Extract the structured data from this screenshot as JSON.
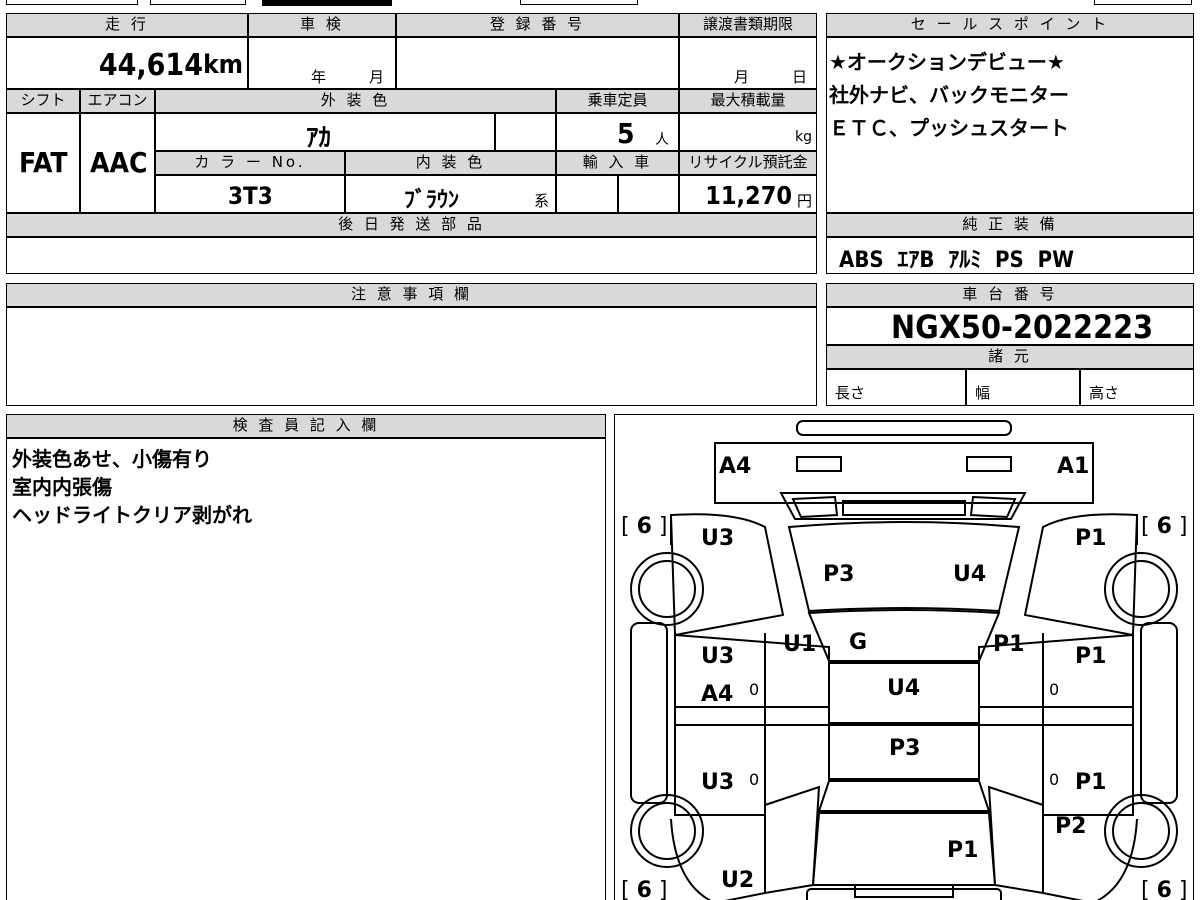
{
  "header": {
    "mileage_label": "走 行",
    "inspection_label": "車 検",
    "registration_label": "登 録 番 号",
    "transfer_deadline_label": "譲渡書類期限",
    "mileage_value": "44,614",
    "mileage_unit": "km",
    "year_unit": "年",
    "month_unit": "月",
    "day_unit": "日"
  },
  "row2": {
    "shift_label": "シフト",
    "ac_label": "エアコン",
    "exterior_color_label": "外 装 色",
    "capacity_label": "乗車定員",
    "max_load_label": "最大積載量",
    "shift_value": "FAT",
    "ac_value": "AAC",
    "exterior_color_value": "ｱｶ",
    "capacity_value": "5",
    "capacity_unit": "人",
    "load_unit": "kg",
    "color_no_label": "カ ラ ー No.",
    "interior_color_label": "内 装 色",
    "import_label": "輸 入 車",
    "recycle_label": "リサイクル預託金",
    "color_no_value": "3T3",
    "interior_color_value": "ﾌﾞﾗｳﾝ",
    "interior_suffix": "系",
    "recycle_value": "11,270",
    "recycle_unit": "円"
  },
  "later_parts": {
    "label": "後 日 発 送 部 品"
  },
  "notes": {
    "label": "注 意 事 項 欄"
  },
  "inspector": {
    "label": "検 査 員 記 入 欄",
    "lines": [
      "外装色あせ、小傷有り",
      "室内内張傷",
      "ヘッドライトクリア剥がれ"
    ]
  },
  "sales_points": {
    "label": "セ ー ル ス ポ イ ン ト",
    "lines": [
      "★オークションデビュー★",
      "社外ナビ、バックモニター",
      "ＥＴＣ、プッシュスタート"
    ]
  },
  "equipment": {
    "label": "純 正 装 備",
    "items": "ABS  ｴｱB  ｱﾙﾐ  PS  PW"
  },
  "chassis": {
    "label": "車 台 番 号",
    "value": "NGX50-2022223"
  },
  "specs": {
    "label": "諸 元",
    "length_label": "長さ",
    "width_label": "幅",
    "height_label": "高さ"
  },
  "diagram": {
    "marks": {
      "front_left": "A4",
      "front_right": "A1",
      "bracket_6": "6",
      "fender_left": "U3",
      "fender_right": "P1",
      "hood_left": "P3",
      "hood_right": "U4",
      "pillar_left": "U1",
      "pillar_right": "P1",
      "windshield": "G",
      "front_door_left": "U3",
      "front_door_left_2": "A4",
      "front_door_right": "P1",
      "roof": "U4",
      "rear_roof": "P3",
      "rear_door_left": "U3",
      "rear_door_right": "P1",
      "rear_fender_right": "P2",
      "trunk": "P1",
      "rear_left": "U2",
      "zero": "0"
    }
  }
}
